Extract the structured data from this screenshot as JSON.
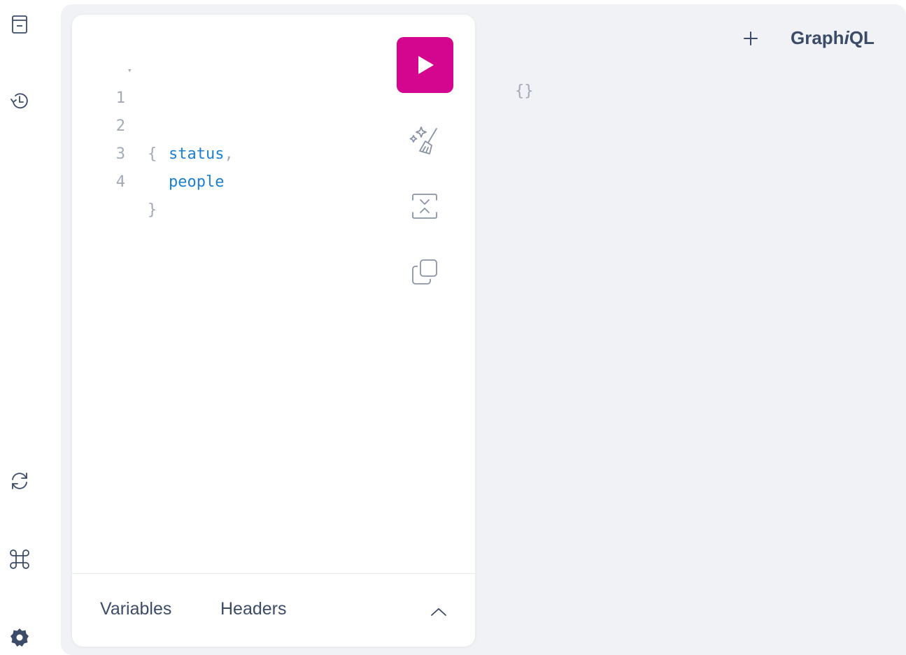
{
  "sidebar": {
    "items": [
      {
        "icon": "docs-icon",
        "name": "sidebar-docs-button"
      },
      {
        "icon": "history-icon",
        "name": "sidebar-history-button"
      },
      {
        "icon": "refetch-icon",
        "name": "sidebar-refetch-schema-button"
      },
      {
        "icon": "command-icon",
        "name": "sidebar-shortcuts-button"
      },
      {
        "icon": "gear-icon",
        "name": "sidebar-settings-button"
      }
    ]
  },
  "editor": {
    "lines": [
      {
        "number": "1",
        "text": "{",
        "folded_marker": "▾",
        "kind": "punct"
      },
      {
        "number": "2",
        "text": "status",
        "suffix": ",",
        "kind": "field"
      },
      {
        "number": "3",
        "text": "people",
        "kind": "field"
      },
      {
        "number": "4",
        "text": "}",
        "kind": "punct"
      }
    ],
    "toolbar": {
      "run_icon": "play-icon",
      "prettify_icon": "prettify-icon",
      "merge_icon": "merge-fragments-icon",
      "copy_icon": "copy-icon"
    },
    "run_button_color": "#d4068f",
    "bottom_tabs": {
      "variables": "Variables",
      "headers": "Headers"
    },
    "toggle_icon": "chevron-up-icon"
  },
  "result": {
    "text": "{}"
  },
  "header": {
    "add_tab_icon": "plus-icon",
    "logo_prefix": "Graph",
    "logo_italic": "i",
    "logo_suffix": "QL"
  },
  "colors": {
    "text": "#3b4b68",
    "muted": "#a3a9b5",
    "field": "#1b7fd6",
    "accent": "#d4068f",
    "shell_bg": "#f0f2f5"
  }
}
